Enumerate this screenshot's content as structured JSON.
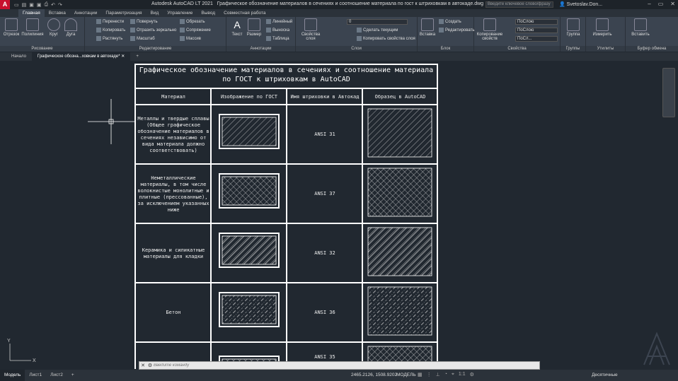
{
  "titlebar": {
    "app_title": "Autodesk AutoCAD LT 2021",
    "doc_title": "Графическое обозначение материалов в сечениях и соотношение материала по гост к штриховкам в автокаде.dwg",
    "search_placeholder": "Введите ключевое слово/фразу",
    "user": "Svetoslav.Don..."
  },
  "ribbon_tabs": [
    "Главная",
    "Вставка",
    "Аннотации",
    "Параметризация",
    "Вид",
    "Управление",
    "Вывод",
    "Совместная работа"
  ],
  "ribbon": {
    "draw": {
      "label": "Рисование",
      "line": "Отрезок",
      "polyline": "Полилиния",
      "circle": "Круг",
      "arc": "Дуга"
    },
    "modify": {
      "label": "Редактирование",
      "move": "Перенести",
      "rotate": "Повернуть",
      "trim": "Обрезать",
      "copy": "Копировать",
      "mirror": "Отразить зеркально",
      "fillet": "Сопряжение",
      "stretch": "Растянуть",
      "scale": "Масштаб",
      "array": "Массив"
    },
    "annotation": {
      "label": "Аннотации",
      "text": "Текст",
      "dimension": "Размер",
      "linear": "Линейный",
      "leader": "Выноска",
      "table": "Таблица"
    },
    "layers": {
      "label": "Слои",
      "props": "Свойства слоя",
      "layer_value": "0",
      "make_current": "Сделать текущим",
      "match": "Копировать свойства слоя"
    },
    "block": {
      "label": "Блок",
      "insert": "Вставка",
      "create": "Создать",
      "edit": "Редактировать"
    },
    "properties": {
      "label": "Свойства",
      "match": "Копирование свойств",
      "color": "ПоСлою",
      "ltype": "ПоСлою",
      "lweight": "ПоСл..."
    },
    "groups": {
      "label": "Группы",
      "group": "Группа"
    },
    "utilities": {
      "label": "Утилиты",
      "measure": "Измерить"
    },
    "clipboard": {
      "label": "Буфер обмена",
      "paste": "Вставить"
    }
  },
  "doc_tabs": [
    "Начало",
    "Графическое обозна...ховкам в автокаде*"
  ],
  "drawing": {
    "title": "Графическое обозначение материалов в сечениях и соотношение материала по ГОСТ к штриховкам в AutoCAD",
    "headers": [
      "Материал",
      "Изображение по ГОСТ",
      "Имя штриховки в Автокад",
      "Образец в AutoCAD"
    ],
    "rows": [
      {
        "material": "Металлы и твердые сплавы (Общее графическое обозначение материалов в сечениях независимо от вида материала должно соответствовать)",
        "hatch": "ANSI 31"
      },
      {
        "material": "Неметаллические материалы, в том числе волокнистые монолитные и плитные (прессованные), за исключением указанных ниже",
        "hatch": "ANSI 37"
      },
      {
        "material": "Керамика и силикатные материалы для кладки",
        "hatch": "ANSI 32"
      },
      {
        "material": "Бетон",
        "hatch": "ANSI 36"
      },
      {
        "material": "",
        "hatch": "ANSI 35"
      }
    ]
  },
  "command": {
    "placeholder": "Введите команду"
  },
  "status": {
    "tabs": [
      "Модель",
      "Лист1",
      "Лист2"
    ],
    "coords": "2465.2126, 1508.9202",
    "mode": "МОДЕЛЬ",
    "scale": "1:1",
    "units": "Десятичные"
  }
}
